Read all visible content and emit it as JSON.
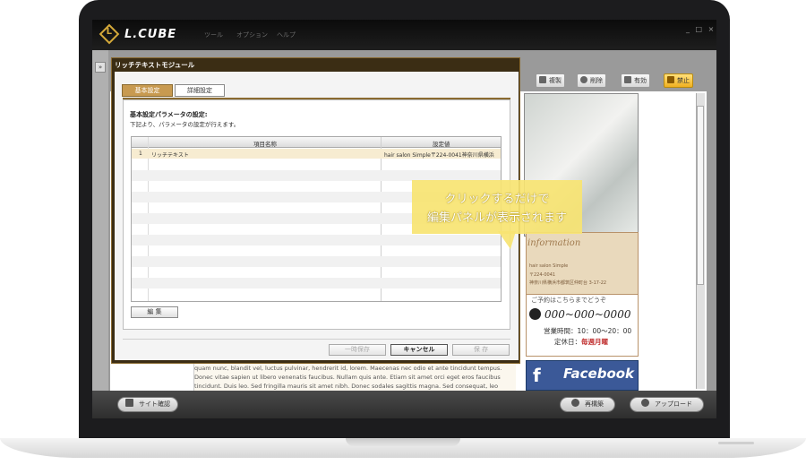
{
  "app": {
    "logo_text": "L.CUBE",
    "menu": [
      "ツール",
      "オプション",
      "ヘルプ"
    ],
    "window_controls": "_ □ ×",
    "expand_icon": "»"
  },
  "toolbar": {
    "duplicate_label": "複製",
    "delete_label": "削除",
    "enable_label": "有効",
    "prohibit_label": "禁止"
  },
  "preview": {
    "info_script": "information",
    "info_name": "hair salon Simple",
    "info_zip": "〒224-0041",
    "info_address": "神奈川県横浜市都筑区仲町台 3-17-22",
    "reserve_label": "ご予約はこちらまでどうぞ",
    "phone": "000~000~0000",
    "hours": "営業時間：10：00～20：00",
    "closed_label": "定休日：",
    "closed_value": "毎週月曜",
    "facebook_icon": "f",
    "facebook_label": "Facebook",
    "lorem": "quam nunc, blandit vel, luctus pulvinar, hendrerit id, lorem. Maecenas nec odio et ante tincidunt tempus. Donec vitae sapien ut libero venenatis faucibus. Nullam quis ante. Etiam sit amet orci eget eros faucibus tincidunt. Duis leo. Sed fringilla mauris sit amet nibh. Donec sodales sagittis magna. Sed consequat, leo"
  },
  "bottombar": {
    "site_check_label": "サイト確認",
    "rebuild_label": "再構築",
    "upload_label": "アップロード"
  },
  "dialog": {
    "title": "リッチテキストモジュール",
    "tabs": [
      {
        "label": "基本設定",
        "active": true
      },
      {
        "label": "詳細設定",
        "active": false
      }
    ],
    "section_title": "基本設定パラメータの設定:",
    "section_desc": "下記より、パラメータの設定が行えます。",
    "grid": {
      "columns": [
        "項目名称",
        "設定値"
      ],
      "rows": [
        {
          "no": "1",
          "name": "リッチテキスト",
          "value": "hair salon Simple〒224-0041神奈川県横浜"
        }
      ]
    },
    "edit_label": "編 集",
    "temp_save_label": "一時保存",
    "cancel_label": "キャンセル",
    "save_label": "保 存"
  },
  "callout": {
    "line1": "クリックするだけで",
    "line2": "編集パネルが表示されます"
  },
  "colors": {
    "accent_gold": "#c89a50",
    "dialog_frame": "#3b2d14",
    "callout": "#f7e472",
    "facebook": "#3b5998"
  }
}
